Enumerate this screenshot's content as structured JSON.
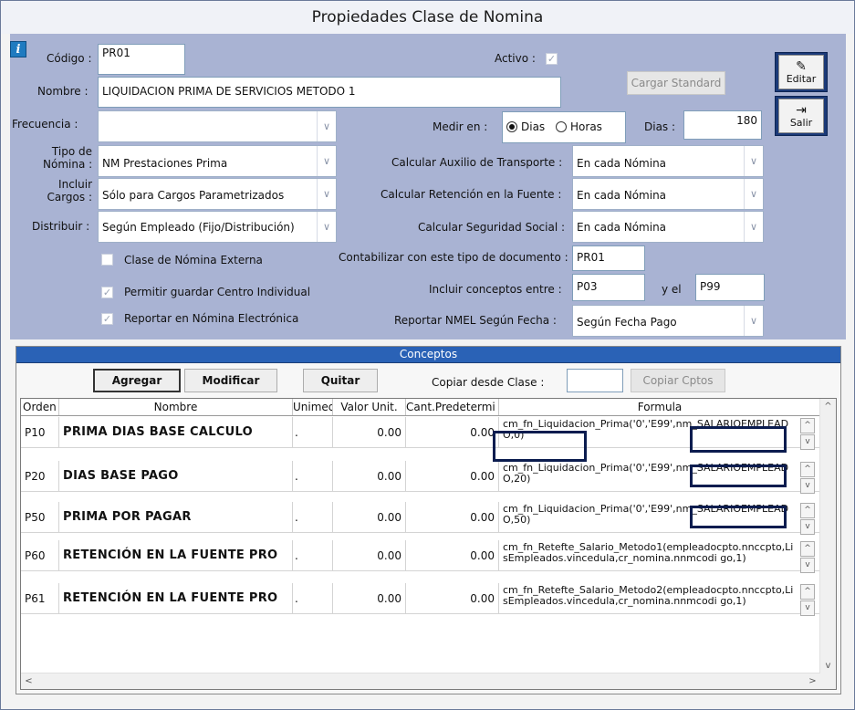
{
  "window": {
    "title": "Propiedades Clase de Nomina"
  },
  "form": {
    "codigo_label": "Código :",
    "codigo_value": "PR01",
    "activo_label": "Activo :",
    "activo_check": "✓",
    "nombre_label": "Nombre :",
    "nombre_value": "LIQUIDACION PRIMA DE SERVICIOS METODO 1",
    "cargar_standard": "Cargar Standard",
    "frecuencia_label": "Frecuencia :",
    "frecuencia_value": "",
    "medir_label": "Medir en :",
    "medir_dias": "Dias",
    "medir_horas": "Horas",
    "dias_label": "Dias :",
    "dias_value": "180",
    "tipo_label_1": "Tipo de",
    "tipo_label_2": "Nómina :",
    "tipo_value": "NM Prestaciones Prima",
    "auxilio_label": "Calcular Auxilio de Transporte :",
    "auxilio_value": "En cada Nómina",
    "incluir_label_1": "Incluir",
    "incluir_label_2": "Cargos :",
    "incluir_value": "Sólo para Cargos Parametrizados",
    "retencion_label": "Calcular Retención en la Fuente :",
    "retencion_value": "En cada Nómina",
    "distribuir_label": "Distribuir :",
    "distribuir_value": "Según Empleado (Fijo/Distribución)",
    "seguridad_label": "Calcular Seguridad Social :",
    "seguridad_value": "En cada Nómina",
    "clase_externa_label": "Clase de Nómina Externa",
    "contabilizar_label": "Contabilizar con este tipo de documento :",
    "contabilizar_value": "PR01",
    "permitir_label": "Permitir guardar Centro Individual",
    "incluir_conceptos_label": "Incluir conceptos entre :",
    "conceptos_desde": "P03",
    "yel_label": "y el",
    "conceptos_hasta": "P99",
    "reportar_nomina_label": "Reportar en Nómina Electrónica",
    "reportar_nmel_label": "Reportar NMEL Según Fecha :",
    "reportar_nmel_value": "Según Fecha Pago",
    "check_mark": "✓"
  },
  "side": {
    "editar": "Editar",
    "salir": "Salir"
  },
  "conceptos": {
    "title": "Conceptos",
    "agregar": "Agregar",
    "modificar": "Modificar",
    "quitar": "Quitar",
    "copiar_label": "Copiar desde Clase :",
    "copiar_value": "",
    "copiar_btn": "Copiar Cptos",
    "columns": [
      "Orden",
      "Nombre",
      "Unimed",
      "Valor Unit.",
      "Cant.Predetermi",
      "Formula"
    ],
    "rows": [
      {
        "orden": "P10",
        "nombre": "PRIMA DIAS BASE CALCULO",
        "unimed": ".",
        "valor": "0.00",
        "cant": "0.00",
        "formula": "cm_fn_Liquidacion_Prima('0','E99',nm_SALARIOEMPLEADO,0)"
      },
      {
        "orden": "P20",
        "nombre": "DIAS BASE PAGO",
        "unimed": ".",
        "valor": "0.00",
        "cant": "0.00",
        "formula": "cm_fn_Liquidacion_Prima('0','E99',nm_SALARIOEMPLEADO,20)"
      },
      {
        "orden": "P50",
        "nombre": "PRIMA POR PAGAR",
        "unimed": ".",
        "valor": "0.00",
        "cant": "0.00",
        "formula": "cm_fn_Liquidacion_Prima('0','E99',nm_SALARIOEMPLEADO,50)"
      },
      {
        "orden": "P60",
        "nombre": "RETENCIÓN EN LA FUENTE PRO",
        "unimed": ".",
        "valor": "0.00",
        "cant": "0.00",
        "formula": "cm_fn_Retefte_Salario_Metodo1(empleadocpto.nnccpto,LisEmpleados.vincedula,cr_nomina.nnmcodi go,1)"
      },
      {
        "orden": "P61",
        "nombre": "RETENCIÓN EN LA FUENTE PRO",
        "unimed": ".",
        "valor": "0.00",
        "cant": "0.00",
        "formula": "cm_fn_Retefte_Salario_Metodo2(empleadocpto.nnccpto,LisEmpleados.vincedula,cr_nomina.nnmcodi go,1)"
      }
    ],
    "spin_up": "^",
    "spin_down": "v"
  },
  "scroll": {
    "up": "^",
    "down": "v",
    "left": "<",
    "right": ">"
  },
  "colors": {
    "panel": "#a9b3d3",
    "header_blue": "#2a62b6",
    "side_button": "#1b3a78",
    "highlight": "#0b1c4f"
  }
}
